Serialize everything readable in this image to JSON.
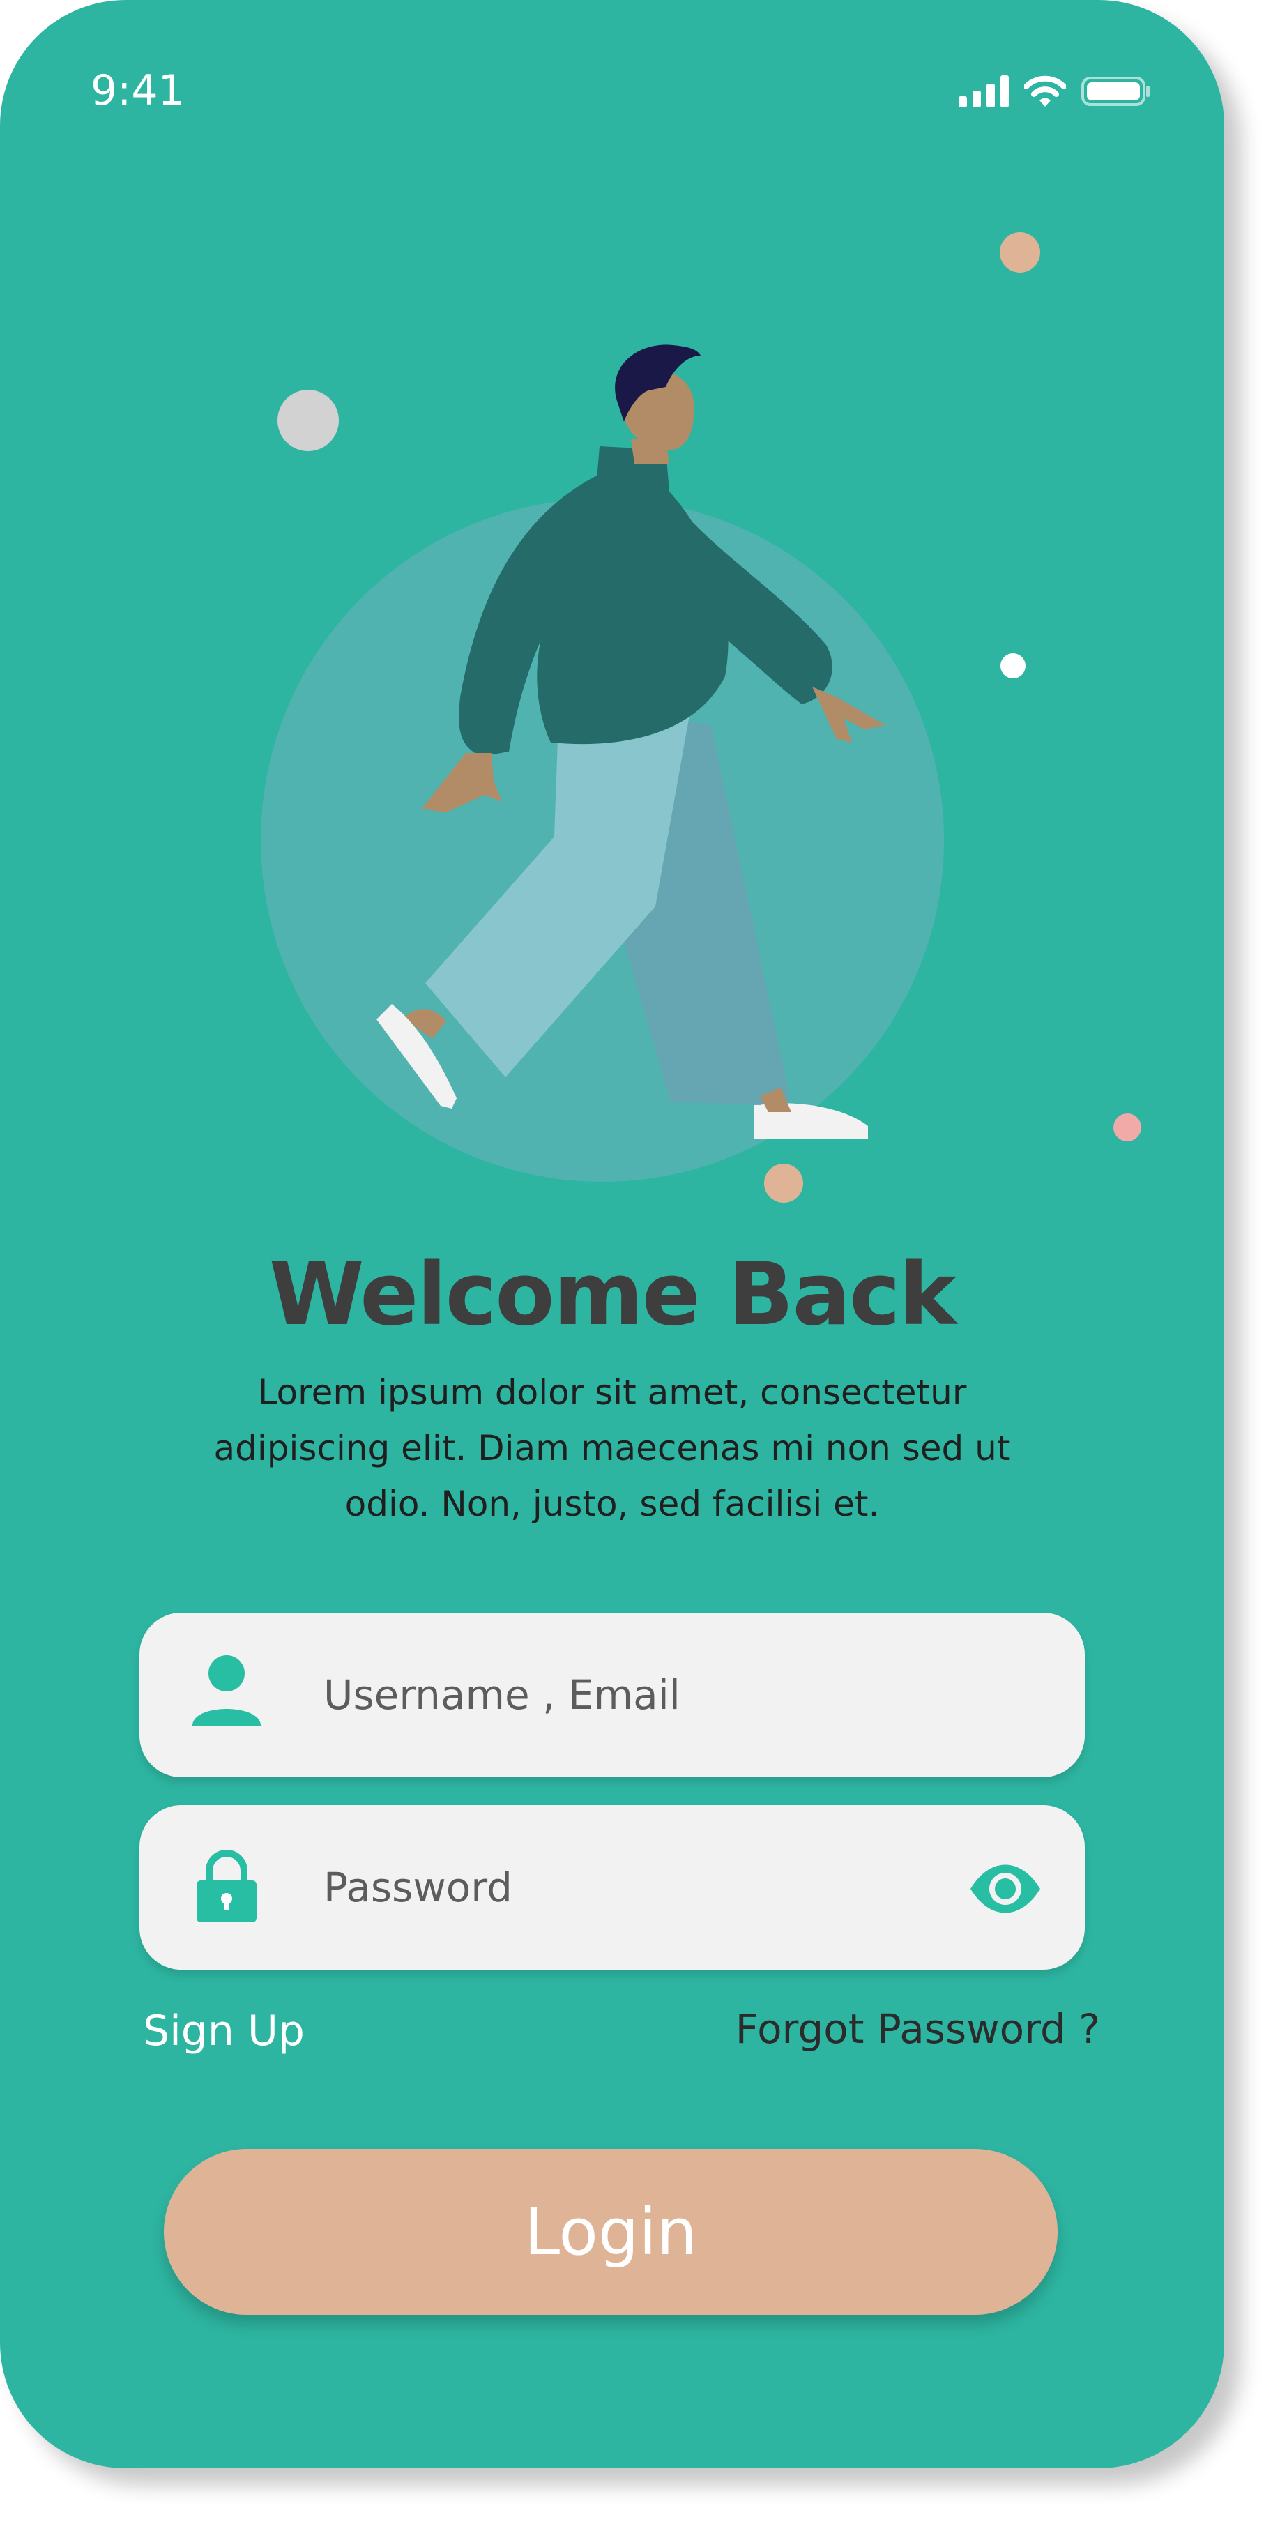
{
  "status_bar": {
    "time": "9:41"
  },
  "welcome": {
    "title": "Welcome Back",
    "subtitle": "Lorem ipsum dolor sit amet, consectetur adipiscing elit. Diam maecenas mi non sed ut odio. Non, justo, sed facilisi et."
  },
  "form": {
    "username_placeholder": "Username , Email",
    "password_placeholder": "Password"
  },
  "links": {
    "signup": "Sign Up",
    "forgot": "Forgot Password ?"
  },
  "login_button": {
    "label": "Login"
  },
  "colors": {
    "background": "#2db5a1",
    "field_background": "#f2f2f2",
    "icon_accent": "#27bea4",
    "login_button": "#dfb496",
    "title_text": "#3e3e3e"
  },
  "icons": [
    "signal-icon",
    "wifi-icon",
    "battery-icon",
    "user-icon",
    "lock-icon",
    "eye-icon"
  ]
}
